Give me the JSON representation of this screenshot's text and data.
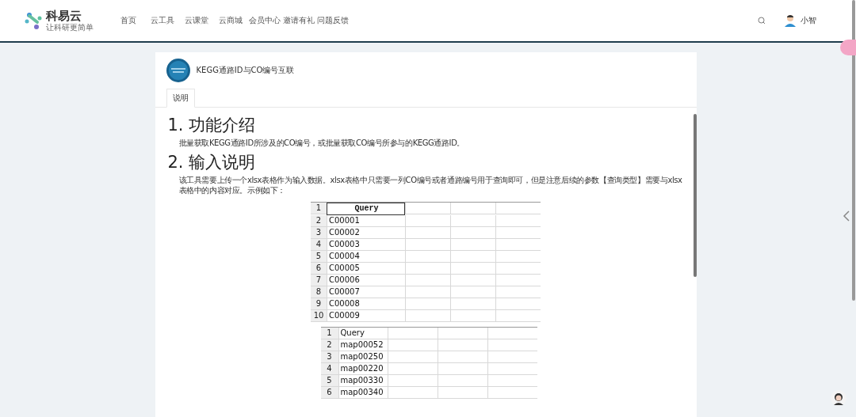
{
  "header": {
    "logo": {
      "name": "科易云",
      "slogan": "让科研更简单"
    },
    "nav": [
      "首页",
      "云工具",
      "云课堂",
      "云商城",
      "会员中心",
      "邀请有礼",
      "问题反馈"
    ],
    "user": {
      "name": "小智"
    }
  },
  "tool": {
    "title": "KEGG通路ID与CO编号互联"
  },
  "tabs": [
    {
      "label": "说明",
      "selected": true
    }
  ],
  "sections": [
    {
      "heading": "1. 功能介绍",
      "text": "批量获取KEGG通路ID所涉及的CO编号，或批量获取CO编号所参与的KEGG通路ID。"
    },
    {
      "heading": "2. 输入说明",
      "text": "该工具需要上传一个xlsx表格作为输入数据。xlsx表格中只需要一列CO编号或者通路编号用于查询即可，但是注意后续的参数【查询类型】需要与xlsx表格中的内容对应。示例如下："
    }
  ],
  "sheets": [
    {
      "kind": "bold-header",
      "rows": [
        [
          "1",
          "Query"
        ],
        [
          "2",
          "C00001"
        ],
        [
          "3",
          "C00002"
        ],
        [
          "4",
          "C00003"
        ],
        [
          "5",
          "C00004"
        ],
        [
          "6",
          "C00005"
        ],
        [
          "7",
          "C00006"
        ],
        [
          "8",
          "C00007"
        ],
        [
          "9",
          "C00008"
        ],
        [
          "10",
          "C00009"
        ]
      ]
    },
    {
      "kind": "plain",
      "rows": [
        [
          "1",
          "Query"
        ],
        [
          "2",
          "map00052"
        ],
        [
          "3",
          "map00250"
        ],
        [
          "4",
          "map00220"
        ],
        [
          "5",
          "map00330"
        ],
        [
          "6",
          "map00340"
        ]
      ]
    }
  ]
}
